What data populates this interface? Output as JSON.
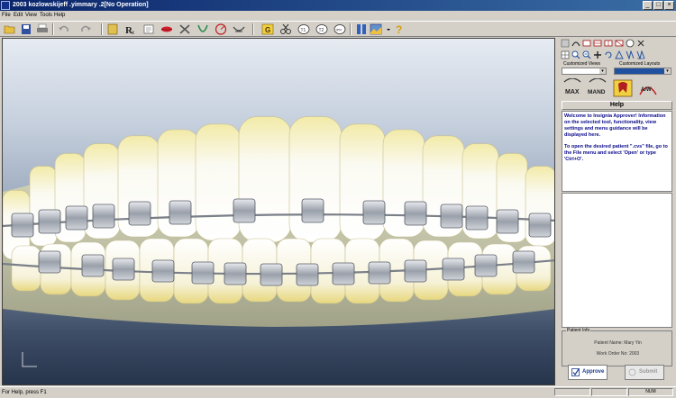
{
  "window": {
    "title": "2003 kozlowskijeff .yimmary .2[No Operation]"
  },
  "menu": [
    {
      "name": "menu-file",
      "label": "File",
      "x": 2
    },
    {
      "name": "menu-edit",
      "label": "Edit",
      "x": 15
    },
    {
      "name": "menu-view",
      "label": "View",
      "x": 28
    },
    {
      "name": "menu-tools",
      "label": "Tools",
      "x": 44
    },
    {
      "name": "menu-help",
      "label": "Help",
      "x": 60
    }
  ],
  "right_panel": {
    "customized_views_label": "Customized Views",
    "customized_layouts_label": "Customized Layouts",
    "big_buttons": [
      "MAX",
      "MAND",
      "",
      "A/W"
    ],
    "help_header": "Help",
    "help_p1": "Welcome to Insignia Approver! Information on the selected tool, functionality, view settings and menu guidance will be displayed here.",
    "help_p2": "To open the desired patient \".cvs\" file, go to the File menu and select 'Open' or type 'Ctrl+O'.",
    "patient_info_label": "Patient Info",
    "patient_name": "Patient Name: Mary Yin",
    "work_order": "Work Order No: 2003",
    "approve_label": "Approve",
    "submit_label": "Submit"
  },
  "status": {
    "text": "For Help, press F1",
    "num": "NUM"
  }
}
